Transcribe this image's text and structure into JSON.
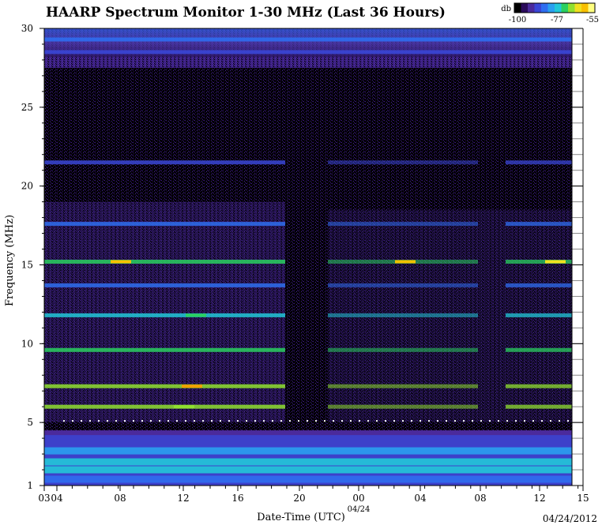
{
  "title": "HAARP Spectrum Monitor 1-30 MHz (Last 36 Hours)",
  "legend": {
    "unit_label": "db",
    "min_label": "-100",
    "mid_label": "-77",
    "max_label": "-55",
    "colors": [
      "#000000",
      "#2a0a5a",
      "#4b2a9c",
      "#3a46d6",
      "#2f6ef0",
      "#2aa0f0",
      "#22c8d8",
      "#2ad060",
      "#90e030",
      "#f0e020",
      "#f8c000",
      "#ffff80"
    ]
  },
  "chart_data": {
    "type": "heatmap",
    "title": "HAARP Spectrum Monitor 1-30 MHz (Last 36 Hours)",
    "xlabel": "Date-Time (UTC)",
    "ylabel": "Frequency (MHz)",
    "ylim": [
      1,
      30
    ],
    "y_ticks": [
      "1",
      "5",
      "10",
      "15",
      "20",
      "25",
      "30"
    ],
    "x_tick_labels": [
      "03",
      "04",
      "08",
      "12",
      "16",
      "20",
      "00",
      "04",
      "08",
      "12",
      "15"
    ],
    "date_marker": "04/24",
    "date_footer": "04/24/2012",
    "color_scale_db": [
      -100,
      -55
    ],
    "bands": [
      {
        "freq_mhz": 29.3,
        "db": -85,
        "note": "full width"
      },
      {
        "freq_mhz": 28.5,
        "db": -88
      },
      {
        "freq_mhz": 21.5,
        "db": -88
      },
      {
        "freq_mhz": 17.6,
        "db": -82
      },
      {
        "freq_mhz": 15.2,
        "db": -70
      },
      {
        "freq_mhz": 13.7,
        "db": -84
      },
      {
        "freq_mhz": 11.8,
        "db": -74
      },
      {
        "freq_mhz": 9.6,
        "db": -72
      },
      {
        "freq_mhz": 7.3,
        "db": -66
      },
      {
        "freq_mhz": 6.0,
        "db": -68
      },
      {
        "freq_mhz": 3.2,
        "db": -80
      },
      {
        "freq_mhz": 2.5,
        "db": -74
      },
      {
        "freq_mhz": 2.0,
        "db": -77
      },
      {
        "freq_mhz": 1.4,
        "db": -82
      }
    ],
    "grid": true
  }
}
